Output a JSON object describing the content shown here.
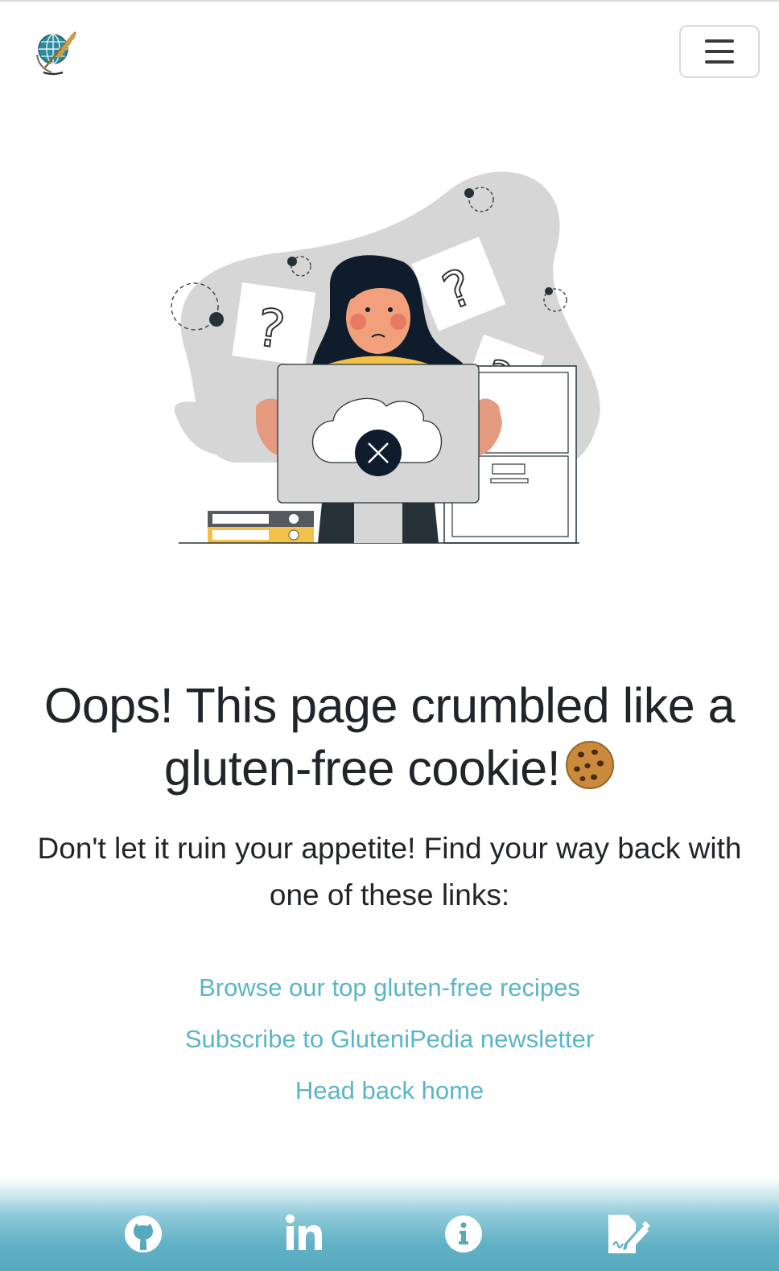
{
  "header": {
    "logo_icon": "globe-wheat-logo-icon",
    "menu_icon": "hamburger-menu-icon"
  },
  "illustration": {
    "icon": "confused-woman-cloud-error-illustration"
  },
  "main": {
    "headline": "Oops! This page crumbled like a gluten-free cookie!",
    "headline_emoji": "cookie-icon",
    "subtext": "Don't let it ruin your appetite! Find your way back with one of these links:",
    "links": [
      {
        "label": "Browse our top gluten-free recipes"
      },
      {
        "label": "Subscribe to GluteniPedia newsletter"
      },
      {
        "label": "Head back home"
      }
    ]
  },
  "footer": {
    "icons": [
      "github-icon",
      "linkedin-icon",
      "info-icon",
      "signature-edit-icon"
    ]
  },
  "colors": {
    "link": "#5bb5c8",
    "footer_gradient_end": "#56a9bf",
    "text": "#212529"
  }
}
